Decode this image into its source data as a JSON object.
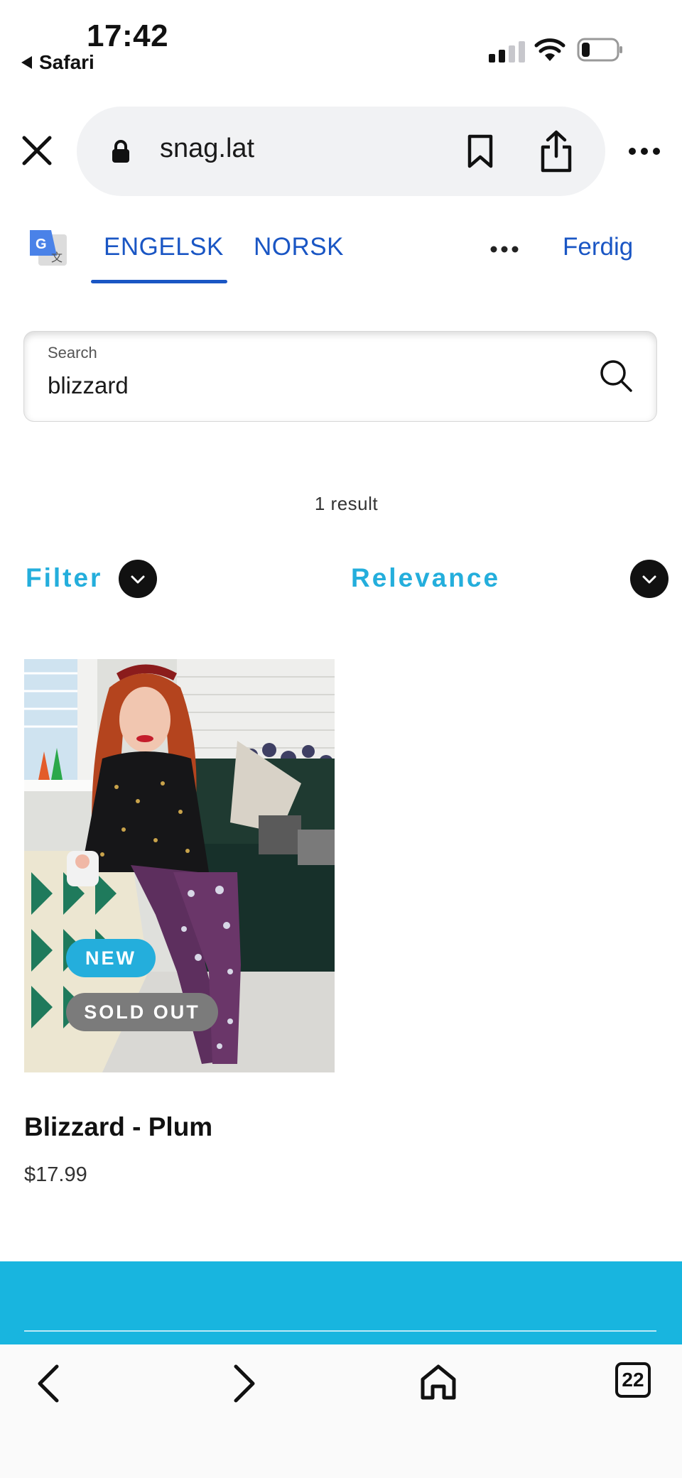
{
  "status_bar": {
    "time": "17:42",
    "back_app": "Safari",
    "battery_level": 0.2
  },
  "browser": {
    "url": "snag.lat",
    "icons": [
      "close-icon",
      "lock-icon",
      "bookmark-icon",
      "share-icon",
      "more-icon"
    ]
  },
  "translate_bar": {
    "tabs": [
      {
        "label": "ENGELSK",
        "selected": true
      },
      {
        "label": "NORSK",
        "selected": false
      }
    ],
    "done_label": "Ferdig"
  },
  "search": {
    "label": "Search",
    "value": "blizzard"
  },
  "results": {
    "count_text": "1 result"
  },
  "controls": {
    "filter_label": "Filter",
    "sort_label": "Relevance"
  },
  "products": [
    {
      "title": "Blizzard - Plum",
      "price": "$17.99",
      "badges": [
        "NEW",
        "SOLD OUT"
      ]
    }
  ],
  "toolbar": {
    "tabs_count": "22"
  },
  "colors": {
    "accent": "#24aedc",
    "link_blue": "#1a56c4",
    "footer": "#18b5df",
    "sold_out": "#7b7b7b"
  }
}
